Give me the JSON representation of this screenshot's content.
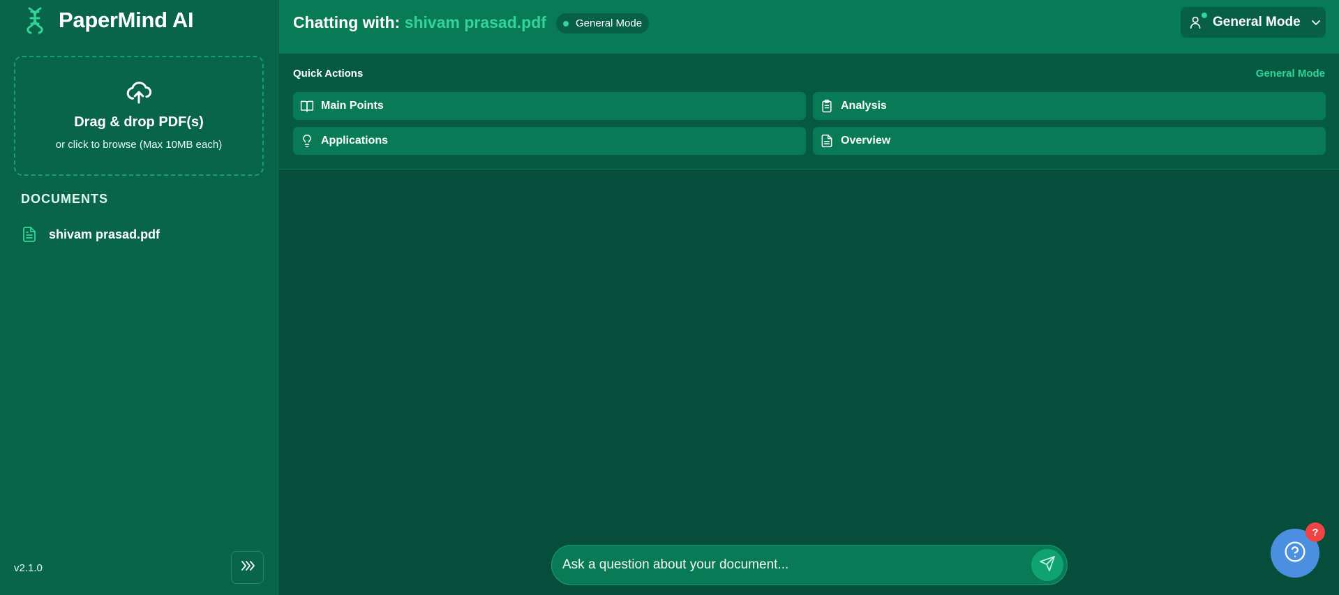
{
  "app": {
    "name": "PaperMind AI",
    "version": "v2.1.0"
  },
  "upload": {
    "title": "Drag & drop PDF(s)",
    "subtitle": "or click to browse (Max 10MB each)"
  },
  "documents": {
    "heading": "DOCUMENTS",
    "items": [
      {
        "name": "shivam prasad.pdf"
      }
    ]
  },
  "header": {
    "chat_prefix": "Chatting with:",
    "chat_document": "shivam prasad.pdf",
    "mode_badge": "General Mode",
    "mode_dropdown": "General Mode"
  },
  "quick_actions": {
    "label": "Quick Actions",
    "mode": "General Mode",
    "buttons": [
      {
        "label": "Main Points",
        "icon": "book-open-icon"
      },
      {
        "label": "Analysis",
        "icon": "clipboard-icon"
      },
      {
        "label": "Applications",
        "icon": "lightbulb-icon"
      },
      {
        "label": "Overview",
        "icon": "file-text-icon"
      }
    ]
  },
  "chat": {
    "placeholder": "Ask a question about your document..."
  },
  "help": {
    "badge": "?"
  },
  "colors": {
    "accent": "#34d399",
    "sidebar": "#086549",
    "header": "#087a56",
    "background": "#064e3b",
    "help": "#4a8fe0",
    "badge": "#ef4444"
  }
}
